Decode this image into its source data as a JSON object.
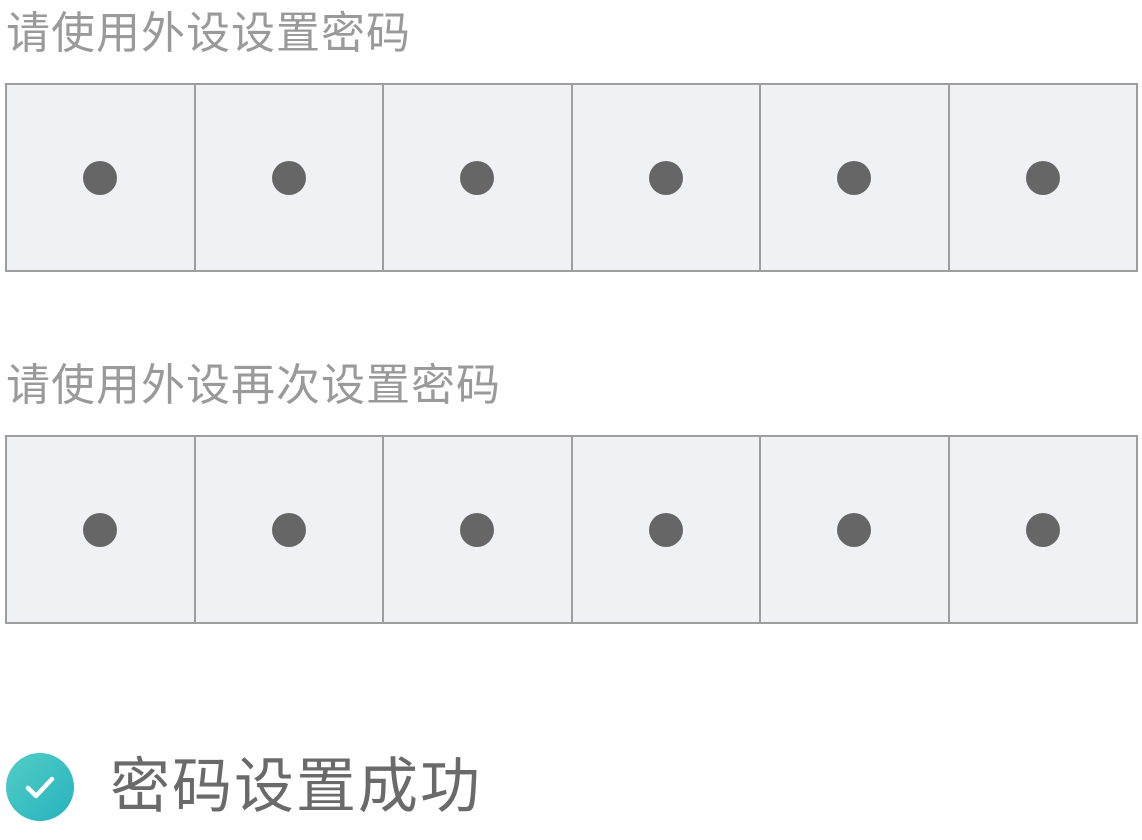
{
  "first_entry": {
    "label": "请使用外设设置密码",
    "digits_entered": 6
  },
  "second_entry": {
    "label": "请使用外设再次设置密码",
    "digits_entered": 6
  },
  "status": {
    "icon": "check-circle-icon",
    "text": "密码设置成功",
    "accent_color": "#3cc2c2"
  },
  "colors": {
    "cell_background": "#f0f1f5",
    "cell_border": "#9e9e9e",
    "dot": "#666666",
    "label_text": "#9a9a9a"
  }
}
